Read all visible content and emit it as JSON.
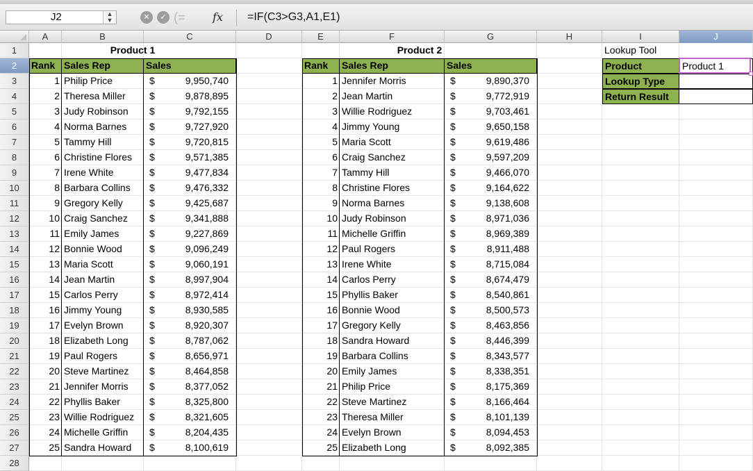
{
  "formula_bar": {
    "name_box": "J2",
    "formula": "=IF(C3>G3,A1,E1)",
    "icons": [
      "cancel-icon",
      "enter-icon",
      "paren-icon",
      "fx-icon"
    ]
  },
  "columns": [
    "A",
    "B",
    "C",
    "D",
    "E",
    "F",
    "G",
    "H",
    "I",
    "J"
  ],
  "selected_column": "J",
  "row_numbers": [
    "1",
    "2",
    "3",
    "4",
    "5",
    "6",
    "7",
    "8",
    "9",
    "10",
    "11",
    "12",
    "13",
    "14",
    "15",
    "16",
    "17",
    "18",
    "19",
    "20",
    "21",
    "22",
    "23",
    "24",
    "25",
    "26",
    "27",
    "28"
  ],
  "selected_row": "2",
  "colors": {
    "header_fill": "#8db14f",
    "selection_border": "#c062c9",
    "header_selected": "#8da7cf"
  },
  "product1": {
    "title": "Product 1",
    "headers": [
      "Rank",
      "Sales Rep",
      "Sales"
    ],
    "currency": "$",
    "rows": [
      [
        "1",
        "Philip Price",
        "9,950,740"
      ],
      [
        "2",
        "Theresa Miller",
        "9,878,895"
      ],
      [
        "3",
        "Judy Robinson",
        "9,792,155"
      ],
      [
        "4",
        "Norma Barnes",
        "9,727,920"
      ],
      [
        "5",
        "Tammy Hill",
        "9,720,815"
      ],
      [
        "6",
        "Christine Flores",
        "9,571,385"
      ],
      [
        "7",
        "Irene White",
        "9,477,834"
      ],
      [
        "8",
        "Barbara Collins",
        "9,476,332"
      ],
      [
        "9",
        "Gregory Kelly",
        "9,425,687"
      ],
      [
        "10",
        "Craig Sanchez",
        "9,341,888"
      ],
      [
        "11",
        "Emily James",
        "9,227,869"
      ],
      [
        "12",
        "Bonnie Wood",
        "9,096,249"
      ],
      [
        "13",
        "Maria Scott",
        "9,060,191"
      ],
      [
        "14",
        "Jean Martin",
        "8,997,904"
      ],
      [
        "15",
        "Carlos Perry",
        "8,972,414"
      ],
      [
        "16",
        "Jimmy Young",
        "8,930,585"
      ],
      [
        "17",
        "Evelyn Brown",
        "8,920,307"
      ],
      [
        "18",
        "Elizabeth Long",
        "8,787,062"
      ],
      [
        "19",
        "Paul Rogers",
        "8,656,971"
      ],
      [
        "20",
        "Steve Martinez",
        "8,464,858"
      ],
      [
        "21",
        "Jennifer Morris",
        "8,377,052"
      ],
      [
        "22",
        "Phyllis Baker",
        "8,325,800"
      ],
      [
        "23",
        "Willie Rodriguez",
        "8,321,605"
      ],
      [
        "24",
        "Michelle Griffin",
        "8,204,435"
      ],
      [
        "25",
        "Sandra Howard",
        "8,100,619"
      ]
    ]
  },
  "product2": {
    "title": "Product 2",
    "headers": [
      "Rank",
      "Sales Rep",
      "Sales"
    ],
    "currency": "$",
    "rows": [
      [
        "1",
        "Jennifer Morris",
        "9,890,370"
      ],
      [
        "2",
        "Jean Martin",
        "9,772,919"
      ],
      [
        "3",
        "Willie Rodriguez",
        "9,703,461"
      ],
      [
        "4",
        "Jimmy Young",
        "9,650,158"
      ],
      [
        "5",
        "Maria Scott",
        "9,619,486"
      ],
      [
        "6",
        "Craig Sanchez",
        "9,597,209"
      ],
      [
        "7",
        "Tammy Hill",
        "9,466,070"
      ],
      [
        "8",
        "Christine Flores",
        "9,164,622"
      ],
      [
        "9",
        "Norma Barnes",
        "9,138,608"
      ],
      [
        "10",
        "Judy Robinson",
        "8,971,036"
      ],
      [
        "11",
        "Michelle Griffin",
        "8,969,389"
      ],
      [
        "12",
        "Paul Rogers",
        "8,911,488"
      ],
      [
        "13",
        "Irene White",
        "8,715,084"
      ],
      [
        "14",
        "Carlos Perry",
        "8,674,479"
      ],
      [
        "15",
        "Phyllis Baker",
        "8,540,861"
      ],
      [
        "16",
        "Bonnie Wood",
        "8,500,573"
      ],
      [
        "17",
        "Gregory Kelly",
        "8,463,856"
      ],
      [
        "18",
        "Sandra Howard",
        "8,446,399"
      ],
      [
        "19",
        "Barbara Collins",
        "8,343,577"
      ],
      [
        "20",
        "Emily James",
        "8,338,351"
      ],
      [
        "21",
        "Philip Price",
        "8,175,369"
      ],
      [
        "22",
        "Steve Martinez",
        "8,166,464"
      ],
      [
        "23",
        "Theresa Miller",
        "8,101,139"
      ],
      [
        "24",
        "Evelyn Brown",
        "8,094,453"
      ],
      [
        "25",
        "Elizabeth Long",
        "8,092,385"
      ]
    ]
  },
  "lookup_tool": {
    "title": "Lookup Tool",
    "labels": [
      "Product",
      "Lookup Type",
      "Return Result"
    ],
    "values": [
      "Product 1",
      "",
      ""
    ]
  }
}
